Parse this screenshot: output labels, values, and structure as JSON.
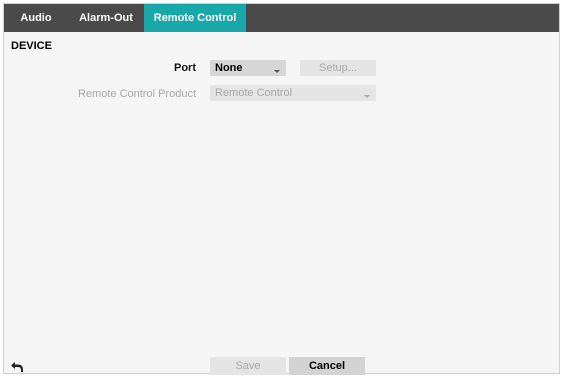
{
  "tabs": [
    {
      "label": "Audio",
      "active": false
    },
    {
      "label": "Alarm-Out",
      "active": false
    },
    {
      "label": "Remote Control",
      "active": true
    }
  ],
  "colors": {
    "tabbar_bg": "#4a4a4a",
    "active_tab_bg": "#19a8aa",
    "disabled_text": "#a8a8a8"
  },
  "section": {
    "title": "DEVICE"
  },
  "port": {
    "label": "Port",
    "value": "None",
    "setup_label": "Setup...",
    "setup_enabled": false
  },
  "remote_control_product": {
    "label": "Remote Control Product",
    "value": "Remote Control",
    "enabled": false
  },
  "footer": {
    "back_icon": "undo-arrow-icon",
    "save_label": "Save",
    "save_enabled": false,
    "cancel_label": "Cancel"
  }
}
